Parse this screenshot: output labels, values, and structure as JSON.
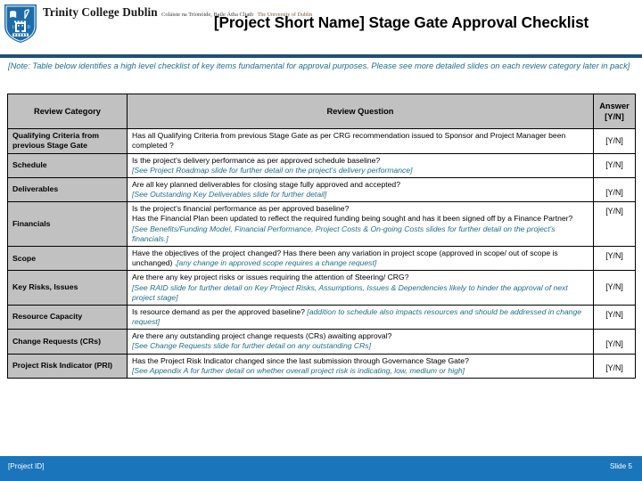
{
  "header": {
    "logo": {
      "crest_icon": "tcd-shield-crest-icon",
      "name": "Trinity College Dublin",
      "irish": "Coláiste na Tríonóide, Baile Átha Cliath",
      "subtitle": "The University of Dublin"
    },
    "title": "[Project Short Name] Stage Gate Approval Checklist",
    "rule_color": "#1f5275"
  },
  "note": "[Note: Table below identifies a high level checklist of key items fundamental for approval purposes. Please see more detailed slides on each review category later in pack]",
  "table": {
    "columns": [
      "Review Category",
      "Review Question",
      "Answer [Y/N]"
    ],
    "answer_header_line1": "Answer",
    "answer_header_line2": "[Y/N]",
    "rows": [
      {
        "category": "Qualifying Criteria from previous Stage Gate",
        "question": "Has all Qualifying Criteria from previous Stage Gate as per CRG recommendation issued to Sponsor and Project Manager been completed ?",
        "note": "",
        "answer": "[Y/N]"
      },
      {
        "category": "Schedule",
        "question": "Is the project's delivery performance as per approved schedule baseline?",
        "note": "[See Project Roadmap  slide for further detail on the project's delivery performance]",
        "answer": "[Y/N]"
      },
      {
        "category": "Deliverables",
        "question": "Are all key planned deliverables for closing stage fully approved and accepted?",
        "note": "[See Outstanding Key Deliverables slide for further detail]",
        "answer": "[Y/N]"
      },
      {
        "category": "Financials",
        "question": "Is the project's financial performance as  per approved baseline?",
        "question2": "Has the Financial Plan been updated to reflect  the required funding being sought and has it been signed off by a Finance Partner?",
        "note": "[See Benefits/Funding Model, Financial Performance, Project Costs & On-going Costs slides for further detail on the project's financials.]",
        "answer": "[Y/N]"
      },
      {
        "category": "Scope",
        "question": "Have the objectives of the project changed?  Has there been any variation in project scope (approved in scope/ out of scope is unchanged) .",
        "note": "[any change in approved scope requires a change request]",
        "answer": "[Y/N]"
      },
      {
        "category": "Key Risks, Issues",
        "question": "Are there any key project risks or issues requiring the attention of Steering/ CRG?",
        "note": "[See RAID slide for further detail on Key Project Risks, Assumptions, Issues & Dependencies likely to hinder the approval of next project stage]",
        "answer": "[Y/N]"
      },
      {
        "category": "Resource Capacity",
        "question": "Is resource demand as per the approved baseline? ",
        "note": "[addition to schedule also impacts resources and should be addressed in change request]",
        "answer": "[Y/N]"
      },
      {
        "category": "Change Requests (CRs)",
        "question": "Are there any outstanding project  change requests (CRs) awaiting approval?",
        "note": "[See Change Requests slide for further detail on any outstanding CRs]",
        "answer": "[Y/N]"
      },
      {
        "category": "Project Risk Indicator (PRI)",
        "question": "Has the Project Risk Indicator changed since the last submission through Governance Stage Gate?",
        "note": "[See Appendix A for further detail on whether overall project risk is indicating, low, medium or high]",
        "answer": "[Y/N]"
      }
    ]
  },
  "footer": {
    "project_id": "[Project ID]",
    "slide_number": "Slide 5",
    "bar_color": "#1b75bb"
  }
}
